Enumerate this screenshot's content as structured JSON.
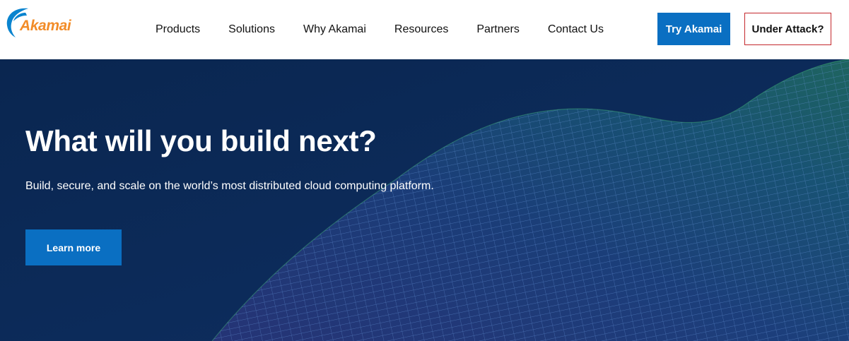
{
  "colors": {
    "brand_orange": "#f28c28",
    "brand_blue": "#0a84cf",
    "button_blue": "#0a6fc2",
    "attack_border": "#c4282c",
    "hero_bg": "#0b2a55"
  },
  "header": {
    "logo": {
      "text": "Akamai",
      "icon": "akamai-wave-logo"
    },
    "nav": [
      {
        "label": "Products"
      },
      {
        "label": "Solutions"
      },
      {
        "label": "Why Akamai"
      },
      {
        "label": "Resources"
      },
      {
        "label": "Partners"
      },
      {
        "label": "Contact Us"
      }
    ],
    "try_button": "Try Akamai",
    "attack_button": "Under Attack?"
  },
  "hero": {
    "title": "What will you build next?",
    "subtitle": "Build, secure, and scale on the world’s most distributed cloud computing platform.",
    "cta": "Learn more"
  }
}
